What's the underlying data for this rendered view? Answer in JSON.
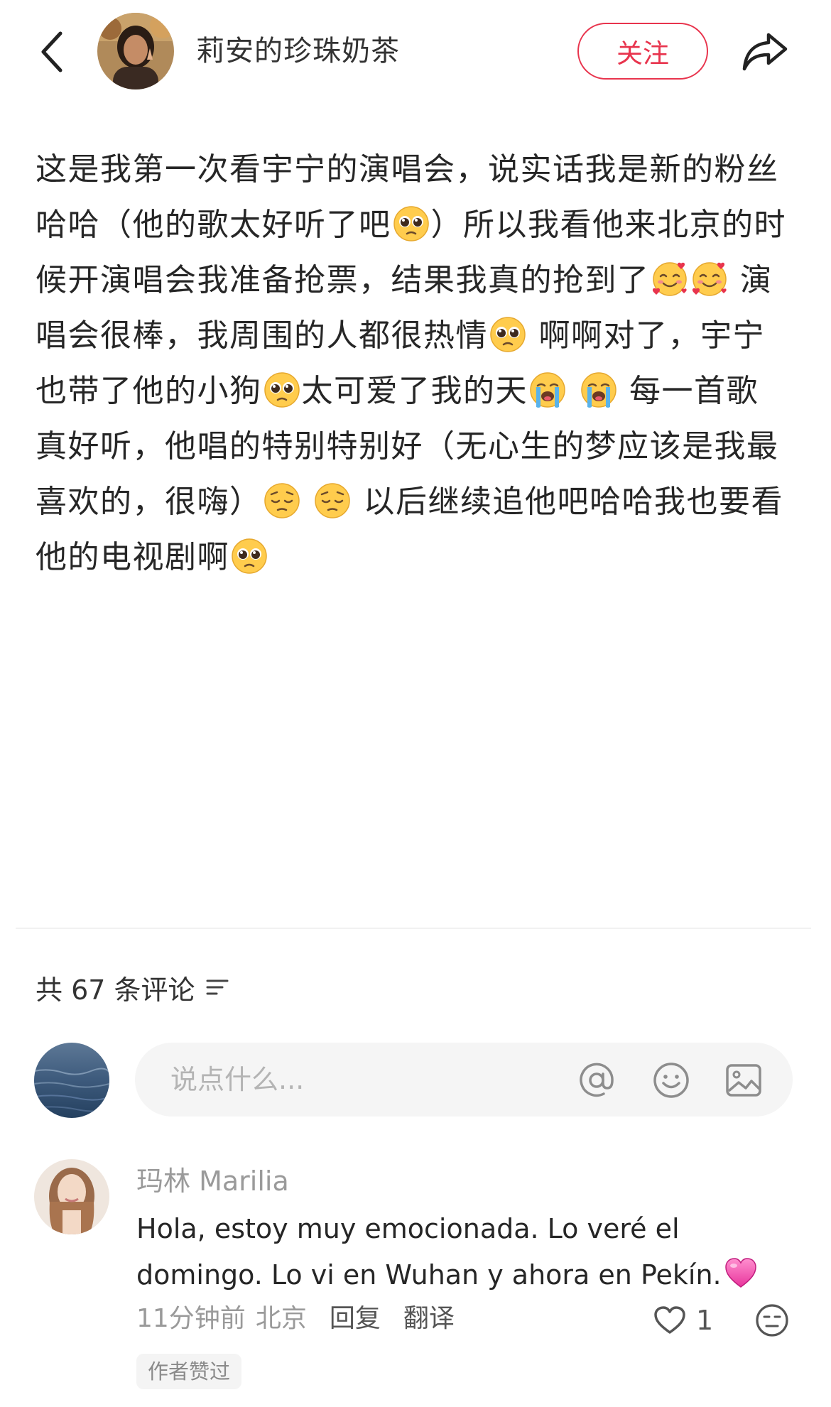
{
  "header": {
    "username": "莉安的珍珠奶茶",
    "follow_label": "关注"
  },
  "post": {
    "segments": [
      {
        "t": "这是我第一次看宇宁的演唱会，说实话我是新的粉丝哈哈（他的歌太好听了吧"
      },
      {
        "e": "pleading"
      },
      {
        "t": "）所以我看他来北京的时候开演唱会我准备抢票，结果我真的抢到了"
      },
      {
        "e": "hearts"
      },
      {
        "e": "hearts"
      },
      {
        "t": " 演唱会很棒，我周围的人都很热情"
      },
      {
        "e": "pleading"
      },
      {
        "t": " 啊啊对了，宇宁也带了他的小狗"
      },
      {
        "e": "pleading"
      },
      {
        "t": "太可爱了我的天"
      },
      {
        "e": "crying"
      },
      {
        "t": " "
      },
      {
        "e": "crying"
      },
      {
        "t": " 每一首歌真好听，他唱的特别特别好（无心生的梦应该是我最喜欢的，很嗨）"
      },
      {
        "e": "pensive"
      },
      {
        "t": " "
      },
      {
        "e": "pensive"
      },
      {
        "t": " 以后继续追他吧哈哈我也要看他的电视剧啊"
      },
      {
        "e": "pleading"
      }
    ]
  },
  "comments_section": {
    "count_label": "共 67 条评论",
    "input_placeholder": "说点什么..."
  },
  "comment": {
    "author": "玛林 Marilia",
    "text": "Hola, estoy muy emocionada. Lo veré el domingo. Lo vi en Wuhan y ahora en Pekín.",
    "emoji": "pink-heart",
    "time": "11分钟前",
    "location": "北京",
    "reply_label": "回复",
    "translate_label": "翻译",
    "likes": "1",
    "author_liked_label": "作者赞过"
  },
  "colors": {
    "accent": "#e8344d",
    "placeholder": "#b4b4b4",
    "meta_text": "#9a9a9a"
  }
}
